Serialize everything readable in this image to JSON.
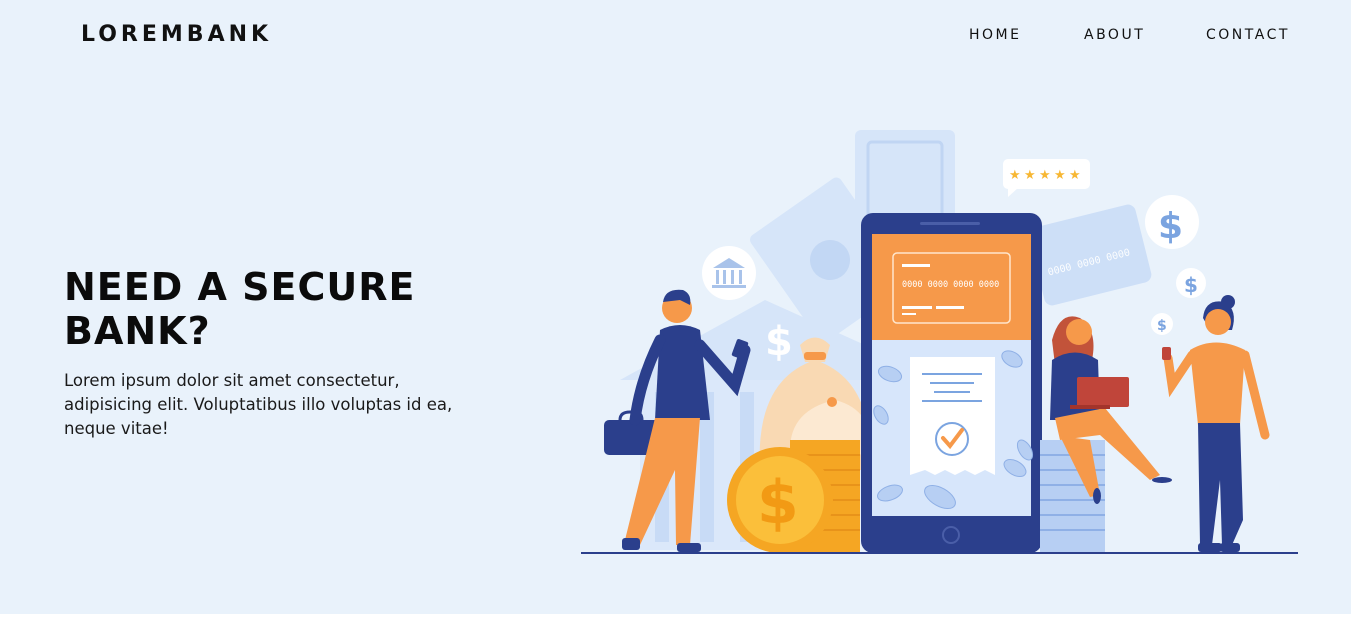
{
  "brand": {
    "name": "LOREMBANK"
  },
  "nav": {
    "items": [
      "HOME",
      "ABOUT",
      "CONTACT"
    ]
  },
  "hero": {
    "headline": "NEED A SECURE BANK?",
    "lead": "Lorem ipsum dolor sit amet consectetur, adipisicing elit. Voluptatibus illo voluptas id ea, neque vitae!"
  },
  "illustration": {
    "card_number_phone": "0000 0000 0000 0000",
    "card_number_back": "0000 0000 0000",
    "rating_stars": 5,
    "colors": {
      "background": "#e9f2fb",
      "navy": "#2b3f8c",
      "orange": "#f6994a",
      "gold": "#f7b733",
      "light_blue": "#c9dcf7"
    }
  }
}
